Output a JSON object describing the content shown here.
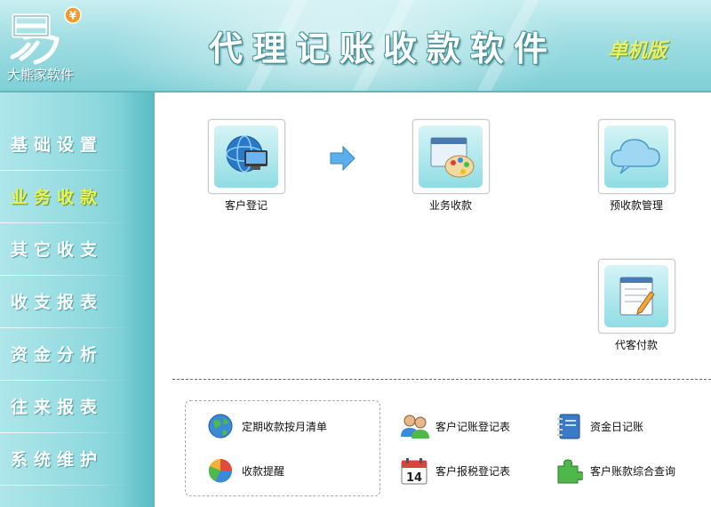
{
  "header": {
    "brand": "大熊家软件",
    "title": "代理记账收款软件",
    "edition": "单机版",
    "logo_icon": "yi-logo-icon",
    "logo_badge": "¥"
  },
  "sidebar": {
    "items": [
      {
        "label": "基础设置",
        "active": false
      },
      {
        "label": "业务收款",
        "active": true
      },
      {
        "label": "其它收支",
        "active": false
      },
      {
        "label": "收支报表",
        "active": false
      },
      {
        "label": "资金分析",
        "active": false
      },
      {
        "label": "往来报表",
        "active": false
      },
      {
        "label": "系统维护",
        "active": false
      }
    ]
  },
  "main": {
    "tiles": [
      {
        "label": "客户登记",
        "icon": "monitor-globe-icon"
      },
      {
        "label": "业务收款",
        "icon": "palette-window-icon"
      },
      {
        "label": "预收款管理",
        "icon": "cloud-icon"
      },
      {
        "label": "代客付款",
        "icon": "notepad-pencil-icon"
      }
    ],
    "links": [
      {
        "label": "定期收款按月清单",
        "icon": "globe-icon"
      },
      {
        "label": "收款提醒",
        "icon": "pie-chart-icon"
      },
      {
        "label": "客户记账登记表",
        "icon": "users-icon"
      },
      {
        "label": "客户报税登记表",
        "icon": "calendar-icon",
        "badge": "14"
      },
      {
        "label": "资金日记账",
        "icon": "notebook-icon"
      },
      {
        "label": "客户账款综合查询",
        "icon": "puzzle-icon"
      }
    ]
  },
  "colors": {
    "header_bg": "#9fdde2",
    "sidebar_bg": "#8fd9de",
    "active_nav": "#e9f257",
    "edition": "#e8f06a"
  }
}
